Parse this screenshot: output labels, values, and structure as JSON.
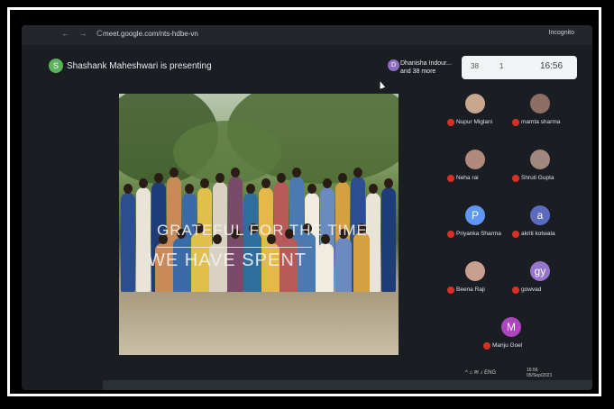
{
  "browser": {
    "url": "meet.google.com/nts-hdbe-vn",
    "mode_label": "Incognito"
  },
  "meeting": {
    "presenter_text": "Shashank Maheshwari is presenting",
    "presenter_initial": "S",
    "host_name": "Dhanisha Indour...",
    "host_more": "and 38 more",
    "host_initial": "D",
    "time": "16:56",
    "count_people": "38",
    "count_chat": "1"
  },
  "slide": {
    "caption_line1": "GRATEFUL FOR THE TIME",
    "caption_line2": "WE HAVE SPENT"
  },
  "participants": [
    {
      "name": "Nupur Miglani",
      "initial": "",
      "color": "#c9a68e"
    },
    {
      "name": "mamta sharma",
      "initial": "",
      "color": "#8d6e63"
    },
    {
      "name": "Neha rai",
      "initial": "",
      "color": "#b08a7a"
    },
    {
      "name": "Shruti Gupta",
      "initial": "",
      "color": "#a1887f"
    },
    {
      "name": "Priyanka Sharma",
      "initial": "P",
      "color": "#5e97f6"
    },
    {
      "name": "akriti kotwala",
      "initial": "a",
      "color": "#5c6bc0"
    },
    {
      "name": "Beena Raji",
      "initial": "",
      "color": "#c8a090"
    },
    {
      "name": "gowvad",
      "initial": "gy",
      "color": "#9575cd"
    },
    {
      "name": "Manju Goel",
      "initial": "M",
      "color": "#ab47bc"
    }
  ],
  "system": {
    "clock_time": "16:56",
    "clock_date": "05/Sep/2021"
  }
}
